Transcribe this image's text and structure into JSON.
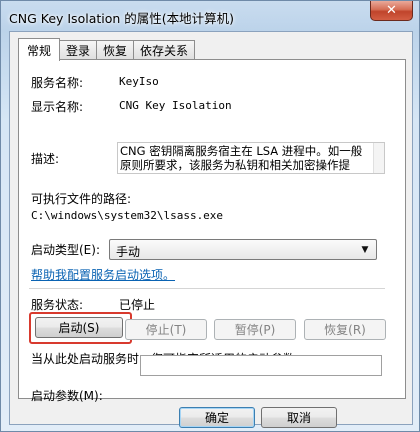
{
  "window": {
    "title": "CNG Key Isolation 的属性(本地计算机)",
    "close_glyph": "✕"
  },
  "tabs": [
    {
      "label": "常规",
      "active": true
    },
    {
      "label": "登录",
      "active": false
    },
    {
      "label": "恢复",
      "active": false
    },
    {
      "label": "依存关系",
      "active": false
    }
  ],
  "general": {
    "service_name_label": "服务名称:",
    "service_name_value": "KeyIso",
    "display_name_label": "显示名称:",
    "display_name_value": "CNG Key Isolation",
    "description_label": "描述:",
    "description_lines": [
      "CNG 密钥隔离服务宿主在 LSA 进程中。如一般",
      "原则所要求，该服务为私钥和相关加密操作提"
    ],
    "exe_path_label": "可执行文件的路径:",
    "exe_path_value": "C:\\windows\\system32\\lsass.exe",
    "startup_type_label": "启动类型(E):",
    "startup_type_value": "手动",
    "help_link": "帮助我配置服务启动选项。",
    "status_label": "服务状态:",
    "status_value": "已停止",
    "buttons": {
      "start": "启动(S)",
      "stop": "停止(T)",
      "pause": "暂停(P)",
      "resume": "恢复(R)"
    },
    "hint": "当从此处启动服务时，您可指定所适用的启动参数。",
    "start_params_label": "启动参数(M):",
    "start_params_value": ""
  },
  "footer": {
    "ok": "确定",
    "cancel": "取消"
  },
  "colors": {
    "highlight": "#d83a2e",
    "link": "#0a63b3"
  }
}
